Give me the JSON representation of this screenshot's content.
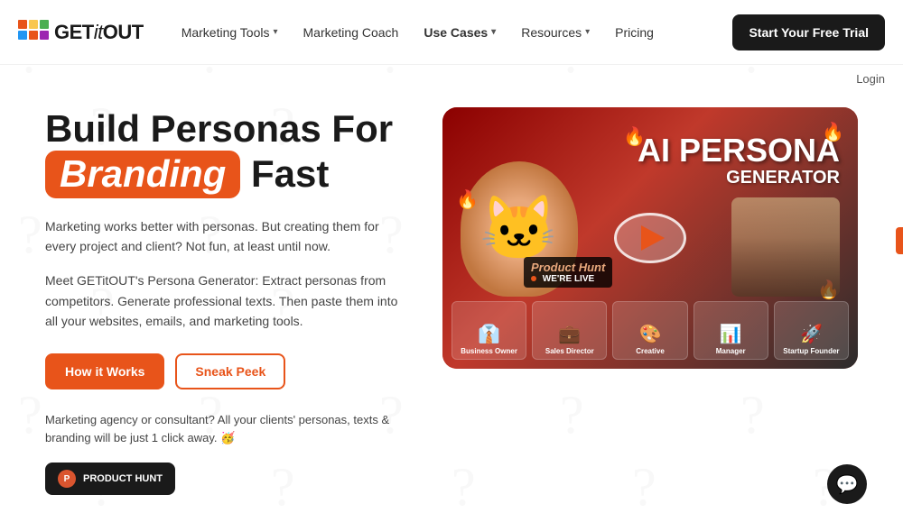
{
  "brand": {
    "logo_text_get": "GET",
    "logo_text_it": "it",
    "logo_text_out": "OUT"
  },
  "nav": {
    "marketing_tools_label": "Marketing Tools",
    "marketing_coach_label": "Marketing Coach",
    "use_cases_label": "Use Cases",
    "resources_label": "Resources",
    "pricing_label": "Pricing",
    "trial_button": "Start Your Free Trial",
    "login_label": "Login"
  },
  "hero": {
    "title_part1": "Build Personas For",
    "title_highlight": "Branding",
    "title_part2": "Fast",
    "desc1": "Marketing works better with personas. But creating them for every project and client? Not fun, at least until now.",
    "desc2": "Meet GETitOUT's Persona Generator: Extract personas from competitors. Generate professional texts. Then paste them into all your websites, emails, and marketing tools.",
    "btn_how": "How it Works",
    "btn_sneak": "Sneak Peek",
    "agency_text": "Marketing agency or consultant? All your clients' personas, texts & branding will be just 1 click away. 🥳",
    "ph_badge": "PRODUCT HUNT"
  },
  "video": {
    "ai_label": "AI PERSONA",
    "generator_label": "GENERATOR",
    "ph_live": "WE'RE LIVE",
    "thumbnails": [
      {
        "label": "Business Owner",
        "emoji": "👔"
      },
      {
        "label": "Sales Director",
        "emoji": "💼"
      },
      {
        "label": "Creative",
        "emoji": "🎨"
      },
      {
        "label": "Manager",
        "emoji": "📊"
      },
      {
        "label": "Startup Founder",
        "emoji": "🚀"
      }
    ]
  },
  "chat": {
    "icon": "💬"
  }
}
